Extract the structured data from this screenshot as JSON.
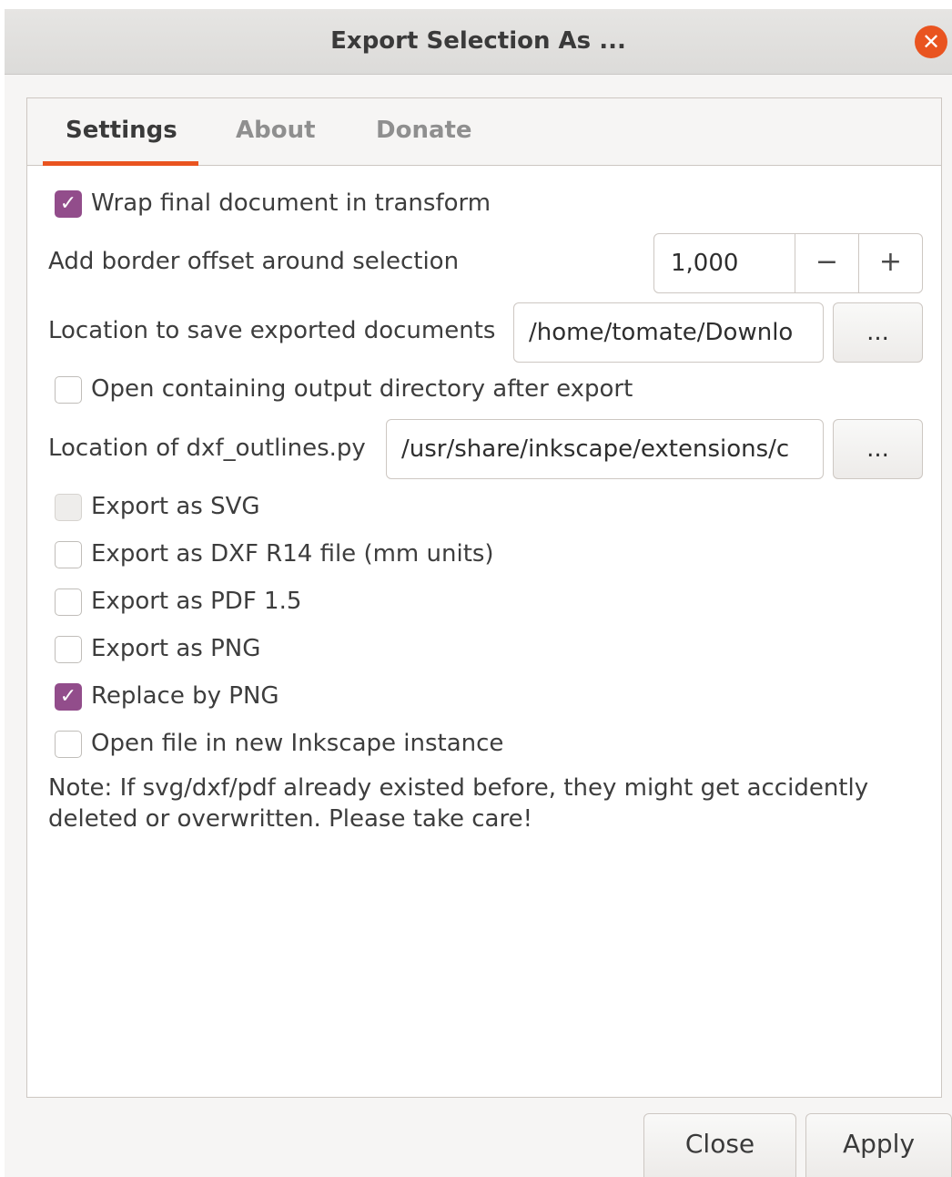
{
  "window": {
    "title": "Export Selection As ...",
    "close_glyph": "✕",
    "accent_color": "#e95420",
    "check_color": "#924d8b"
  },
  "tabs": [
    {
      "label": "Settings",
      "active": true
    },
    {
      "label": "About",
      "active": false
    },
    {
      "label": "Donate",
      "active": false
    }
  ],
  "settings": {
    "wrap": {
      "label": "Wrap final document in transform",
      "checked": true
    },
    "border_offset": {
      "label": "Add border offset around selection",
      "value": "1,000",
      "minus": "−",
      "plus": "+"
    },
    "location_save": {
      "label": "Location to save exported documents",
      "value": "/home/tomate/Downlo",
      "browse": "..."
    },
    "open_dir": {
      "label": "Open containing output directory after export",
      "checked": false
    },
    "dxf_outlines": {
      "label": "Location of dxf_outlines.py",
      "value": "/usr/share/inkscape/extensions/c",
      "browse": "..."
    },
    "export_svg": {
      "label": "Export as SVG",
      "checked": false,
      "disabled": true
    },
    "export_dxf": {
      "label": "Export as DXF R14 file (mm units)",
      "checked": false
    },
    "export_pdf": {
      "label": "Export as PDF 1.5",
      "checked": false
    },
    "export_png": {
      "label": "Export as PNG",
      "checked": false
    },
    "replace_png": {
      "label": "Replace by PNG",
      "checked": true
    },
    "open_new": {
      "label": "Open file in new Inkscape instance",
      "checked": false
    },
    "check_glyph": "✓",
    "note": "Note: If svg/dxf/pdf already existed before, they might get accidently deleted or overwritten. Please take care!"
  },
  "footer": {
    "close_label": "Close",
    "apply_label": "Apply"
  }
}
